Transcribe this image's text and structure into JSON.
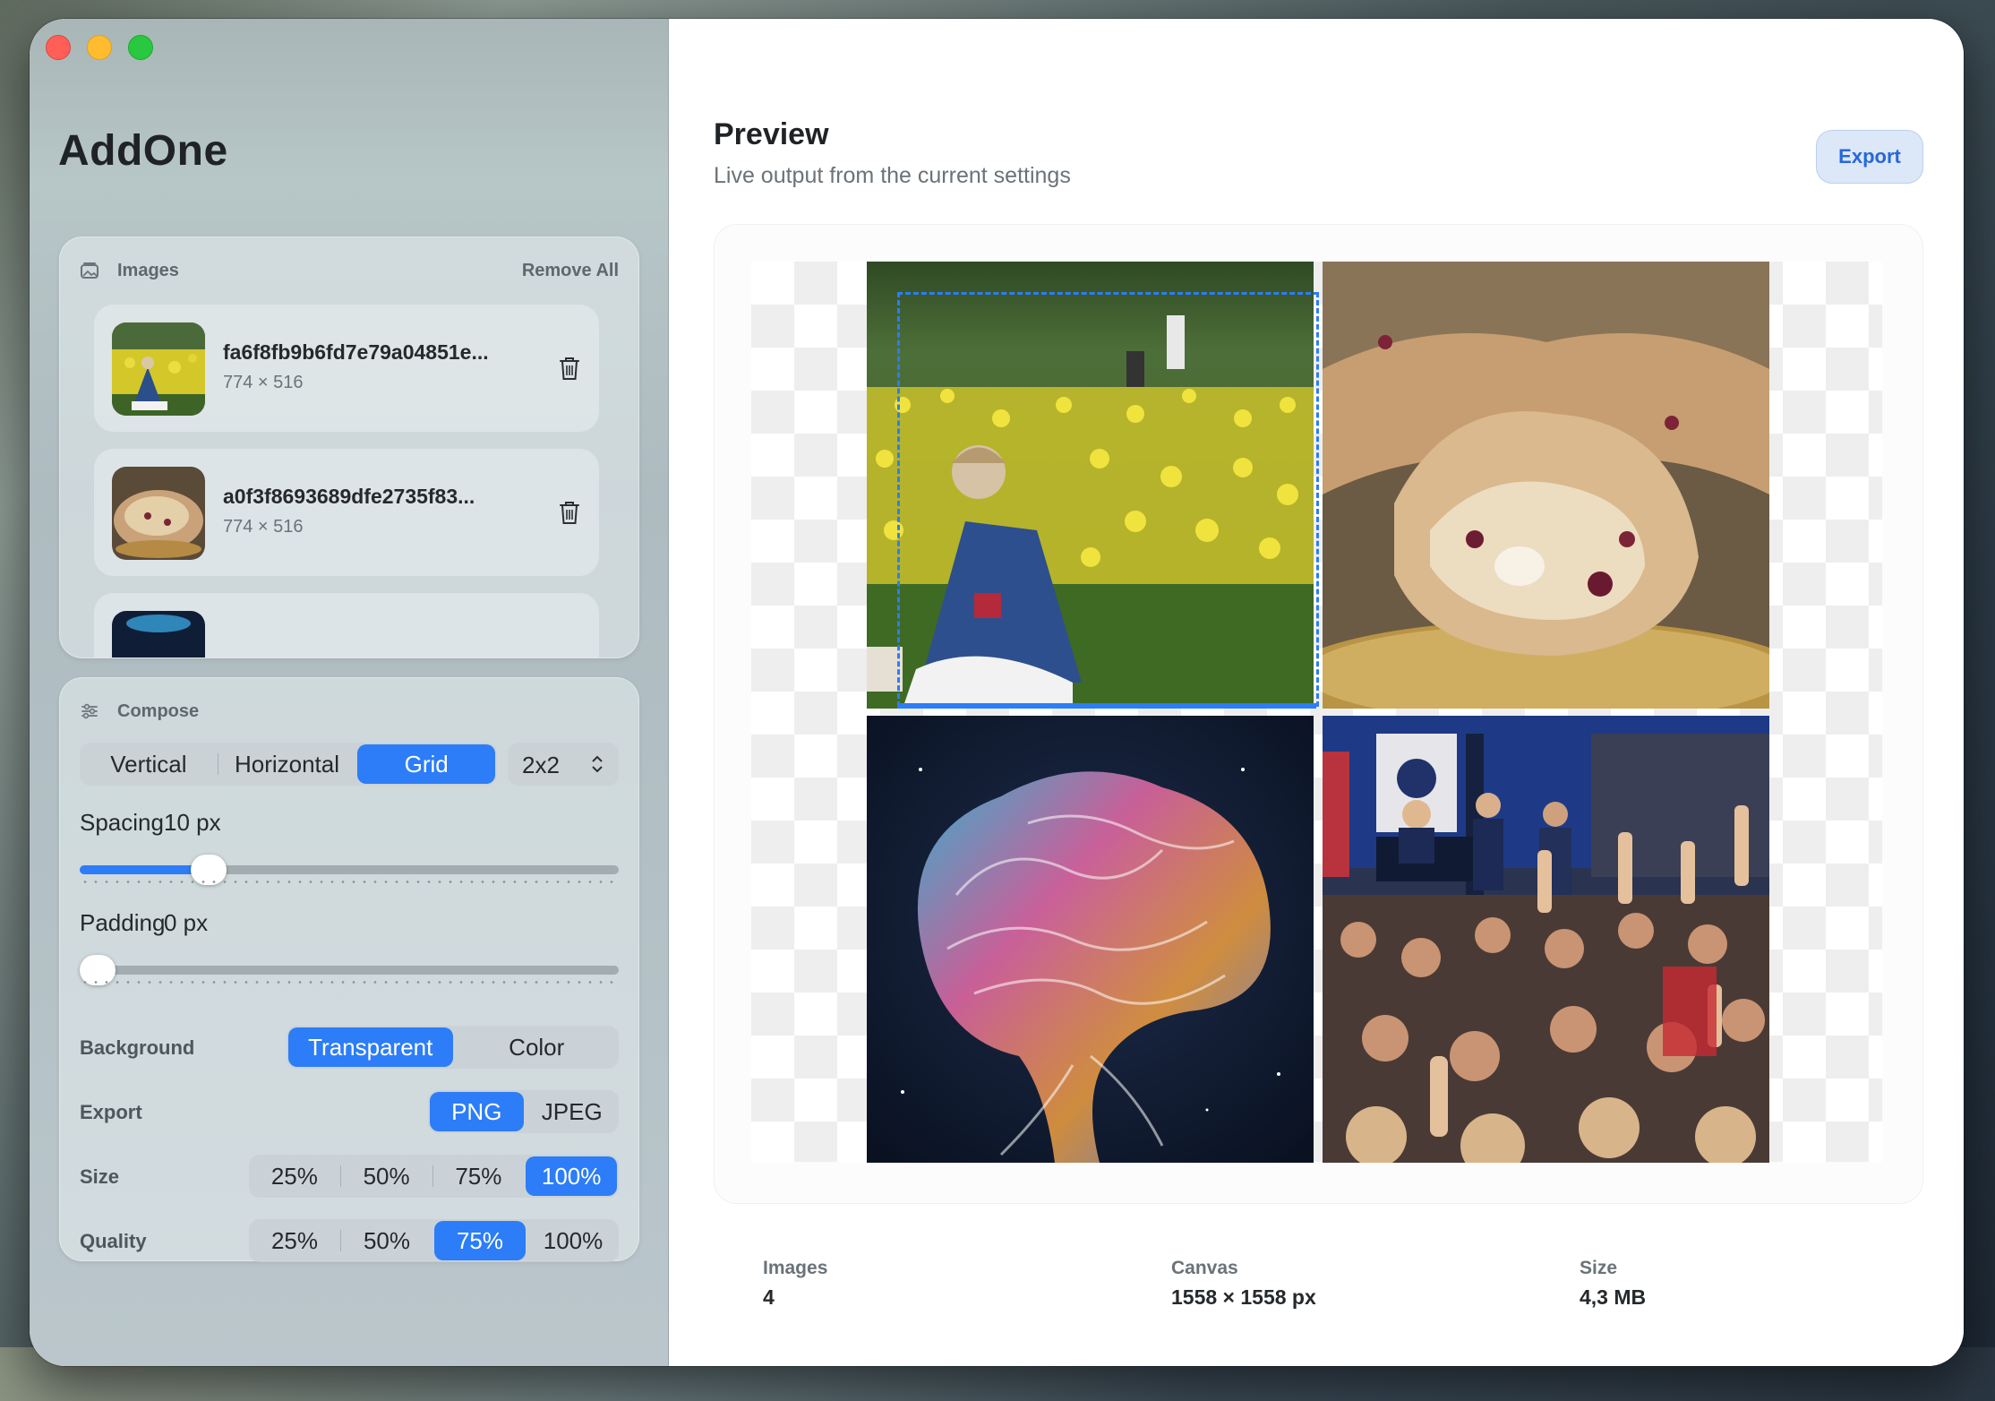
{
  "app": {
    "title": "AddOne"
  },
  "images_panel": {
    "label": "Images",
    "remove_all": "Remove All",
    "items": [
      {
        "name": "fa6f8fb9b6fd7e79a04851e...",
        "dims": "774 × 516"
      },
      {
        "name": "a0f3f8693689dfe2735f83...",
        "dims": "774 × 516"
      }
    ]
  },
  "compose": {
    "label": "Compose",
    "layout_options": [
      "Vertical",
      "Horizontal",
      "Grid"
    ],
    "layout_selected": "Grid",
    "grid_size": "2x2",
    "spacing_label": "Spacing",
    "spacing_value": "10 px",
    "spacing_fraction": 0.22,
    "padding_label": "Padding",
    "padding_value": "0 px",
    "padding_fraction": 0.0,
    "background_label": "Background",
    "background_options": [
      "Transparent",
      "Color"
    ],
    "background_selected": "Transparent",
    "export_label": "Export",
    "export_options": [
      "PNG",
      "JPEG"
    ],
    "export_selected": "PNG",
    "size_label": "Size",
    "size_options": [
      "25%",
      "50%",
      "75%",
      "100%"
    ],
    "size_selected": "100%",
    "quality_label": "Quality",
    "quality_options": [
      "25%",
      "50%",
      "75%",
      "100%"
    ],
    "quality_selected": "75%"
  },
  "preview": {
    "title": "Preview",
    "subtitle": "Live output from the current settings",
    "export_button": "Export"
  },
  "stats": {
    "images_label": "Images",
    "images_value": "4",
    "canvas_label": "Canvas",
    "canvas_value": "1558 × 1558 px",
    "size_label": "Size",
    "size_value": "4,3 MB"
  },
  "colors": {
    "accent": "#2c7df7",
    "sidebar": "#b2c0c5"
  }
}
